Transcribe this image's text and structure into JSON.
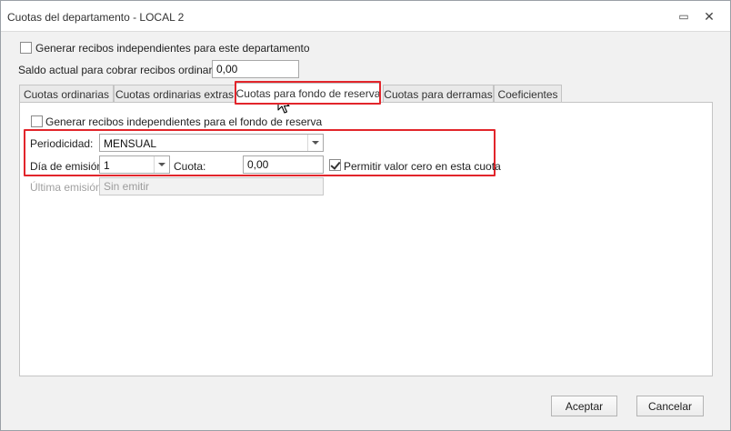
{
  "window": {
    "title": "Cuotas del departamento - LOCAL 2",
    "restore_glyph": "▭",
    "close_glyph": "✕"
  },
  "top": {
    "independent_receipts_label": "Generar recibos independientes para este departamento",
    "independent_receipts_checked": false,
    "balance_label": "Saldo actual para cobrar recibos ordinarios:",
    "balance_value": "0,00"
  },
  "tabs": [
    {
      "label": "Cuotas ordinarias",
      "active": false
    },
    {
      "label": "Cuotas ordinarias extras",
      "active": false
    },
    {
      "label": "Cuotas para fondo de reserva",
      "active": true
    },
    {
      "label": "Cuotas para derramas",
      "active": false
    },
    {
      "label": "Coeficientes",
      "active": false
    }
  ],
  "panel": {
    "reserve_receipts_label": "Generar recibos independientes para el fondo de reserva",
    "reserve_receipts_checked": false,
    "periodicity_label": "Periodicidad:",
    "periodicity_value": "MENSUAL",
    "issue_day_label": "Día de emisión:",
    "issue_day_value": "1",
    "fee_label": "Cuota:",
    "fee_value": "0,00",
    "allow_zero_label": "Permitir valor cero en esta cuota",
    "allow_zero_checked": true,
    "last_issue_label": "Última emisión:",
    "last_issue_value": "Sin emitir"
  },
  "footer": {
    "accept_label": "Aceptar",
    "cancel_label": "Cancelar"
  },
  "colors": {
    "highlight": "#e2252b",
    "window_bg": "#f1f1f1",
    "panel_bg": "#ffffff"
  }
}
